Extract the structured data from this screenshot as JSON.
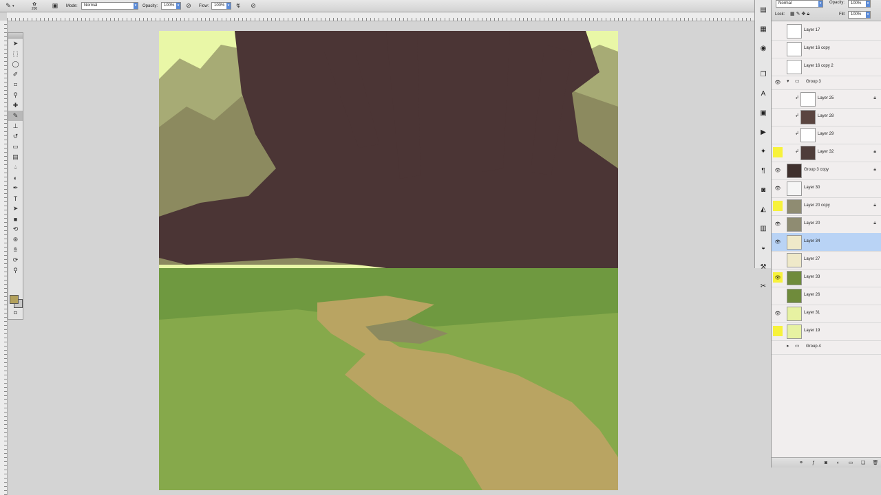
{
  "options_bar": {
    "brush_size": "200",
    "mode_label": "Mode:",
    "mode_value": "Normal",
    "opacity_label": "Opacity:",
    "opacity_value": "100%",
    "flow_label": "Flow:",
    "flow_value": "100%"
  },
  "toolbox": {
    "tools": [
      "move-icon",
      "marquee-icon",
      "lasso-icon",
      "quick-select-icon",
      "crop-icon",
      "eyedropper-icon",
      "healing-icon",
      "brush-icon",
      "stamp-icon",
      "history-brush-icon",
      "eraser-icon",
      "gradient-icon",
      "blur-icon",
      "dodge-icon",
      "pen-icon",
      "type-icon",
      "path-select-icon",
      "shape-icon",
      "3d-rotate-icon",
      "3d-orbit-icon",
      "hand-icon",
      "rotate-view-icon",
      "zoom-icon"
    ],
    "selected_tool": "brush-icon",
    "foreground_color": "#b3a15c",
    "background_color": "#c8c8c8"
  },
  "panel_strip": {
    "icons": [
      "histogram-icon",
      "swatches-icon",
      "info-icon",
      "layers-icon",
      "character-icon",
      "navigator-icon",
      "actions-icon",
      "styles-icon",
      "paragraph-icon",
      "masks-icon",
      "adjustments-icon",
      "channels-icon",
      "paths-icon",
      "tool-presets-icon",
      "brushes-icon"
    ]
  },
  "layers_panel": {
    "blend_mode": "Normal",
    "opacity_label": "Opacity:",
    "opacity_value": "100%",
    "lock_label": "Lock:",
    "fill_label": "Fill:",
    "fill_value": "100%",
    "rows": [
      {
        "name": "Layer 17",
        "visible": false,
        "highlight": false,
        "thumb": "#ffffff",
        "indent": false,
        "clip": false,
        "lock": false
      },
      {
        "name": "Layer 16 copy",
        "visible": false,
        "highlight": false,
        "thumb": "#ffffff",
        "indent": false,
        "clip": false,
        "lock": false
      },
      {
        "name": "Layer 16 copy 2",
        "visible": false,
        "highlight": false,
        "thumb": "#ffffff",
        "indent": false,
        "clip": false,
        "lock": false
      },
      {
        "name": "Group 3",
        "group": true,
        "expanded": true,
        "visible": true,
        "highlight": false
      },
      {
        "name": "Layer 25",
        "visible": false,
        "highlight": false,
        "thumb": "#ffffff",
        "indent": true,
        "clip": true,
        "lock": true
      },
      {
        "name": "Layer 28",
        "visible": false,
        "highlight": false,
        "thumb": "#5a4540",
        "indent": true,
        "clip": true,
        "lock": false
      },
      {
        "name": "Layer 29",
        "visible": false,
        "highlight": false,
        "thumb": "#ffffff",
        "indent": true,
        "clip": true,
        "lock": false
      },
      {
        "name": "Layer 32",
        "visible": false,
        "highlight": true,
        "thumb": "#4e3d3a",
        "indent": true,
        "clip": true,
        "lock": true
      },
      {
        "name": "Group 3 copy",
        "visible": true,
        "highlight": false,
        "thumb": "#3f302d",
        "indent": false,
        "clip": false,
        "lock": true
      },
      {
        "name": "Layer 30",
        "visible": true,
        "highlight": false,
        "thumb": "#f5f5f5",
        "indent": false,
        "clip": false,
        "lock": false
      },
      {
        "name": "Layer 20 copy",
        "visible": false,
        "highlight": true,
        "thumb": "#8f8c72",
        "indent": false,
        "clip": false,
        "lock": true
      },
      {
        "name": "Layer 20",
        "visible": true,
        "highlight": false,
        "thumb": "#8f8c72",
        "indent": false,
        "clip": false,
        "lock": true
      },
      {
        "name": "Layer 34",
        "visible": true,
        "highlight": false,
        "thumb": "#efe9c9",
        "indent": false,
        "clip": false,
        "lock": false,
        "selected": true
      },
      {
        "name": "Layer 27",
        "visible": false,
        "highlight": false,
        "thumb": "#efe9c9",
        "indent": false,
        "clip": false,
        "lock": false
      },
      {
        "name": "Layer 33",
        "visible": true,
        "highlight": true,
        "thumb": "#6f8b3b",
        "indent": false,
        "clip": false,
        "lock": false
      },
      {
        "name": "Layer 26",
        "visible": false,
        "highlight": false,
        "thumb": "#6f8b3b",
        "indent": false,
        "clip": false,
        "lock": false
      },
      {
        "name": "Layer 31",
        "visible": true,
        "highlight": false,
        "thumb": "#e7f2a2",
        "indent": false,
        "clip": false,
        "lock": false
      },
      {
        "name": "Layer 19",
        "visible": false,
        "highlight": true,
        "thumb": "#e7f2a2",
        "indent": false,
        "clip": false,
        "lock": false
      },
      {
        "name": "Group 4",
        "group": true,
        "expanded": false,
        "visible": false,
        "highlight": false
      }
    ],
    "footer_icons": [
      "link-layers-icon",
      "fx-icon",
      "mask-icon",
      "adjustment-layer-icon",
      "new-group-icon",
      "new-layer-icon",
      "trash-icon"
    ]
  },
  "colors": {
    "sky": "#e9f7a7",
    "tree_dark": "#4b3535",
    "foliage_mid": "#8c8a5f",
    "grass": "#6f9940",
    "grass_light": "#86a94b",
    "path": "#b9a462",
    "selected_row": "#b9d3f5",
    "eye_highlight": "#f7f23b"
  }
}
